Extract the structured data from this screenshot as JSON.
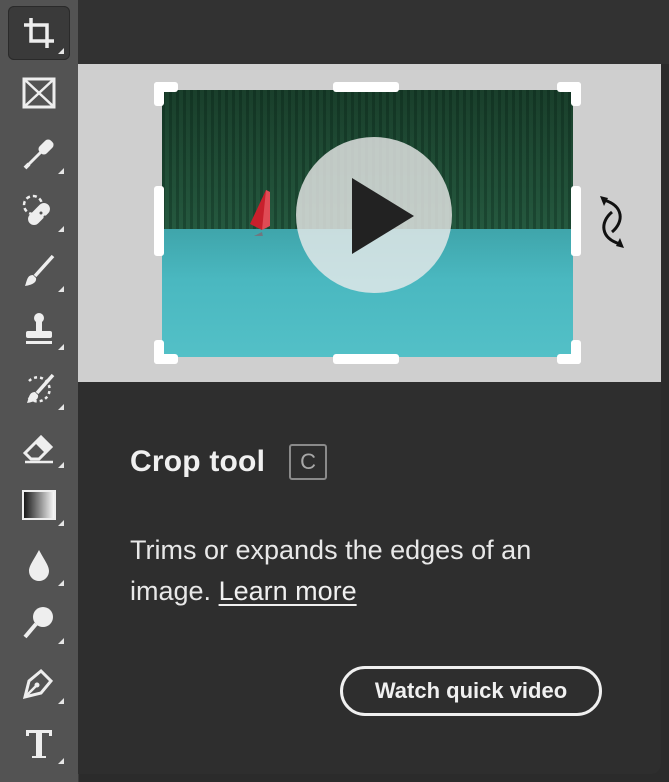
{
  "toolbar": {
    "tools": [
      {
        "name": "crop-icon",
        "active": true
      },
      {
        "name": "frame-icon"
      },
      {
        "name": "eyedropper-icon"
      },
      {
        "name": "healing-brush-icon"
      },
      {
        "name": "brush-icon"
      },
      {
        "name": "clone-stamp-icon"
      },
      {
        "name": "history-brush-icon"
      },
      {
        "name": "eraser-icon"
      },
      {
        "name": "gradient-icon"
      },
      {
        "name": "blur-icon"
      },
      {
        "name": "dodge-icon"
      },
      {
        "name": "pen-icon"
      },
      {
        "name": "type-icon"
      }
    ]
  },
  "tooltip": {
    "title": "Crop tool",
    "shortcut": "C",
    "description": "Trims or expands the edges of an image.",
    "learn_more": "Learn more",
    "video_button": "Watch quick video"
  },
  "colors": {
    "toolbar_bg": "#535353",
    "panel_bg": "#2e2e2e",
    "preview_bg": "#cfcfcf",
    "text": "#f0f0f0"
  }
}
